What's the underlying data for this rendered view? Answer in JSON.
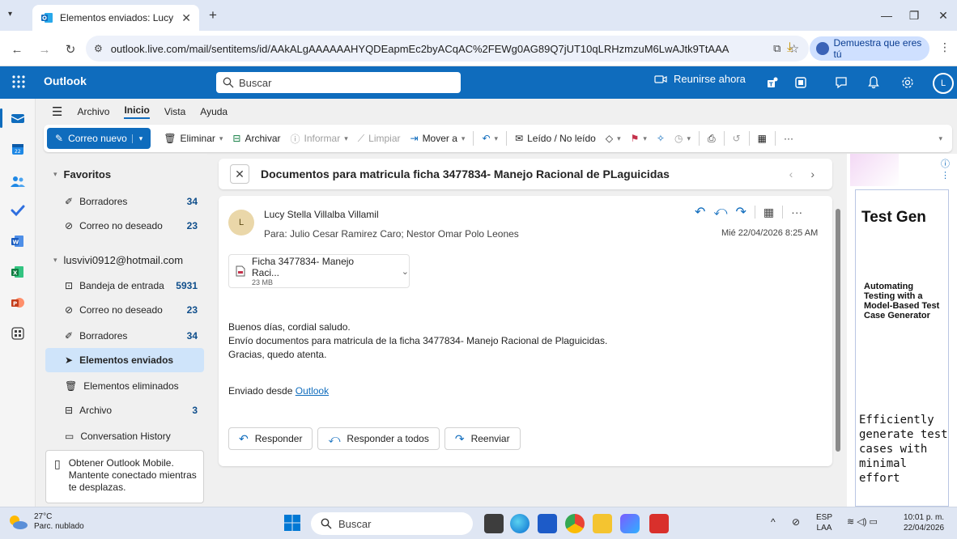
{
  "browser": {
    "tab_title": "Elementos enviados: Lucy Stella",
    "tab_close": "✕",
    "new_tab": "+",
    "url": "outlook.live.com/mail/sentitems/id/AAkALgAAAAAAHYQDEapmEc2byACqAC%2FEWg0AG89Q7jUT10qLRHzmzuM6LwAJtk9TtAAA",
    "profile_pill": "Demuestra que eres tú"
  },
  "header": {
    "brand": "Outlook",
    "search_placeholder": "Buscar",
    "meet_now": "Reunirse ahora",
    "avatar_initial": "L"
  },
  "ribbon_tabs": [
    "Archivo",
    "Inicio",
    "Vista",
    "Ayuda"
  ],
  "ribbon": {
    "new_mail": "Correo nuevo",
    "delete": "Eliminar",
    "archive": "Archivar",
    "report": "Informar",
    "sweep": "Limpiar",
    "move_to": "Mover a",
    "read_unread": "Leído / No leído",
    "more": "···"
  },
  "folders": {
    "favorites_header": "Favoritos",
    "favorites": [
      {
        "label": "Borradores",
        "count": "34"
      },
      {
        "label": "Correo no deseado",
        "count": "23"
      }
    ],
    "account_header": "lusvivi0912@hotmail.com",
    "account_items": [
      {
        "label": "Bandeja de entrada",
        "count": "5931"
      },
      {
        "label": "Correo no deseado",
        "count": "23"
      },
      {
        "label": "Borradores",
        "count": "34"
      },
      {
        "label": "Elementos enviados",
        "count": ""
      },
      {
        "label": "Elementos eliminados",
        "count": ""
      },
      {
        "label": "Archivo",
        "count": "3"
      },
      {
        "label": "Conversation History",
        "count": ""
      }
    ],
    "mobile_card": "Obtener Outlook Mobile. Mantente conectado mientras te desplazas."
  },
  "message": {
    "subject": "Documentos para matricula ficha 3477834- Manejo Racional de PLaguicidas",
    "sender": "Lucy Stella Villalba Villamil",
    "avatar_initial": "L",
    "to": "Para:  Julio Cesar Ramirez Caro;  Nestor Omar Polo Leones",
    "date": "Mié 22/04/2026 8:25 AM",
    "attachment_name": "Ficha 3477834- Manejo Raci...",
    "attachment_size": "23 MB",
    "body_lines": [
      "Buenos días, cordial saludo.",
      "Envío documentos para matricula de la ficha 3477834- Manejo Racional de Plaguicidas.",
      "Gracias, quedo atenta."
    ],
    "sent_from_prefix": "Enviado desde ",
    "sent_from_link": "Outlook",
    "reply": "Responder",
    "reply_all": "Responder a todos",
    "forward": "Reenviar",
    "more": "···"
  },
  "ad": {
    "title": "Test Gen",
    "subtitle": "Automating Testing with a Model-Based Test Case Generator",
    "mono": "Efficiently generate test cases with minimal effort"
  },
  "taskbar": {
    "temp": "27°C",
    "weather": "Parc. nublado",
    "search": "Buscar",
    "lang1": "ESP",
    "lang2": "LAA",
    "time": "10:01 p. m.",
    "date": "22/04/2026"
  },
  "colors": {
    "outlook_blue": "#0f6cbd",
    "selected_folder": "#cfe4fa",
    "avatar_bg": "#ead7a9"
  }
}
